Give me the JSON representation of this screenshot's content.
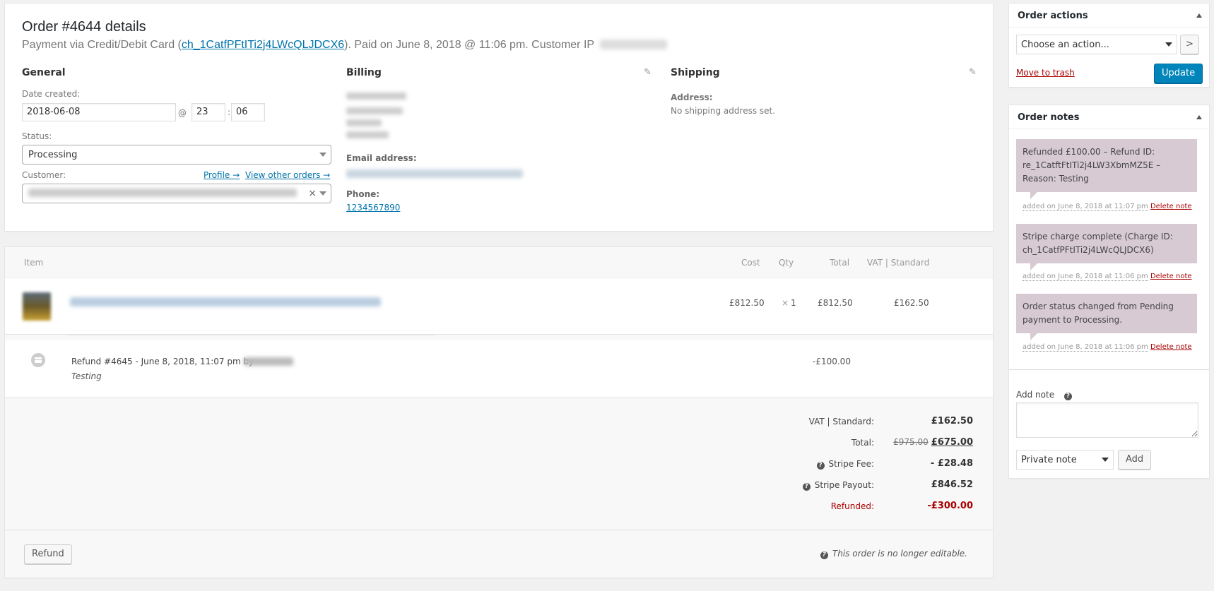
{
  "order": {
    "title": "Order #4644 details",
    "meta_prefix": "Payment via Credit/Debit Card (",
    "charge_id": "ch_1CatfPFtITi2j4LWcQLJDCX6",
    "meta_suffix": "). Paid on June 8, 2018 @ 11:06 pm. Customer IP",
    "general": {
      "heading": "General",
      "date_label": "Date created:",
      "date_value": "2018-06-08",
      "at": "@",
      "hour": "23",
      "colon": ":",
      "minute": "06",
      "status_label": "Status:",
      "status_value": "Processing",
      "customer_label": "Customer:",
      "profile_link": "Profile →",
      "view_orders_link": "View other orders →",
      "clear_icon": "×"
    },
    "billing": {
      "heading": "Billing",
      "email_label": "Email address:",
      "phone_label": "Phone:",
      "phone_value": "1234567890"
    },
    "shipping": {
      "heading": "Shipping",
      "address_label": "Address:",
      "address_value": "No shipping address set."
    }
  },
  "items": {
    "headers": {
      "item": "Item",
      "cost": "Cost",
      "qty": "Qty",
      "total": "Total",
      "vat": "VAT | Standard"
    },
    "line": {
      "cost": "£812.50",
      "qty_prefix": "×",
      "qty": "1",
      "total": "£812.50",
      "vat": "£162.50"
    },
    "refund": {
      "title": "Refund #4645 - June 8, 2018, 11:07 pm by",
      "reason": "Testing",
      "amount": "-£100.00"
    },
    "totals": {
      "vat_label": "VAT | Standard:",
      "vat_value": "£162.50",
      "total_label": "Total:",
      "total_old": "£975.00",
      "total_value": "£675.00",
      "fee_label": "Stripe Fee:",
      "fee_value": "- £28.48",
      "payout_label": "Stripe Payout:",
      "payout_value": "£846.52",
      "refunded_label": "Refunded:",
      "refunded_value": "-£300.00"
    },
    "refund_button": "Refund",
    "not_editable": "This order is no longer editable."
  },
  "actions": {
    "title": "Order actions",
    "select_value": "Choose an action...",
    "go_label": ">",
    "trash_link": "Move to trash",
    "update_button": "Update"
  },
  "notes": {
    "title": "Order notes",
    "items": [
      {
        "text": "Refunded £100.00 – Refund ID: re_1CatftFtITi2j4LW3XbmMZ5E – Reason: Testing",
        "added": "added on June 8, 2018 at 11:07 pm",
        "delete": "Delete note"
      },
      {
        "text": "Stripe charge complete (Charge ID: ch_1CatfPFtITi2j4LWcQLJDCX6)",
        "added": "added on June 8, 2018 at 11:06 pm",
        "delete": "Delete note"
      },
      {
        "text": "Order status changed from Pending payment to Processing.",
        "added": "added on June 8, 2018 at 11:06 pm",
        "delete": "Delete note"
      }
    ],
    "add_label": "Add note",
    "type_value": "Private note",
    "add_button": "Add"
  },
  "colors": {
    "primary": "#0085ba",
    "note_bg": "#d7cad2",
    "danger": "#a00"
  }
}
